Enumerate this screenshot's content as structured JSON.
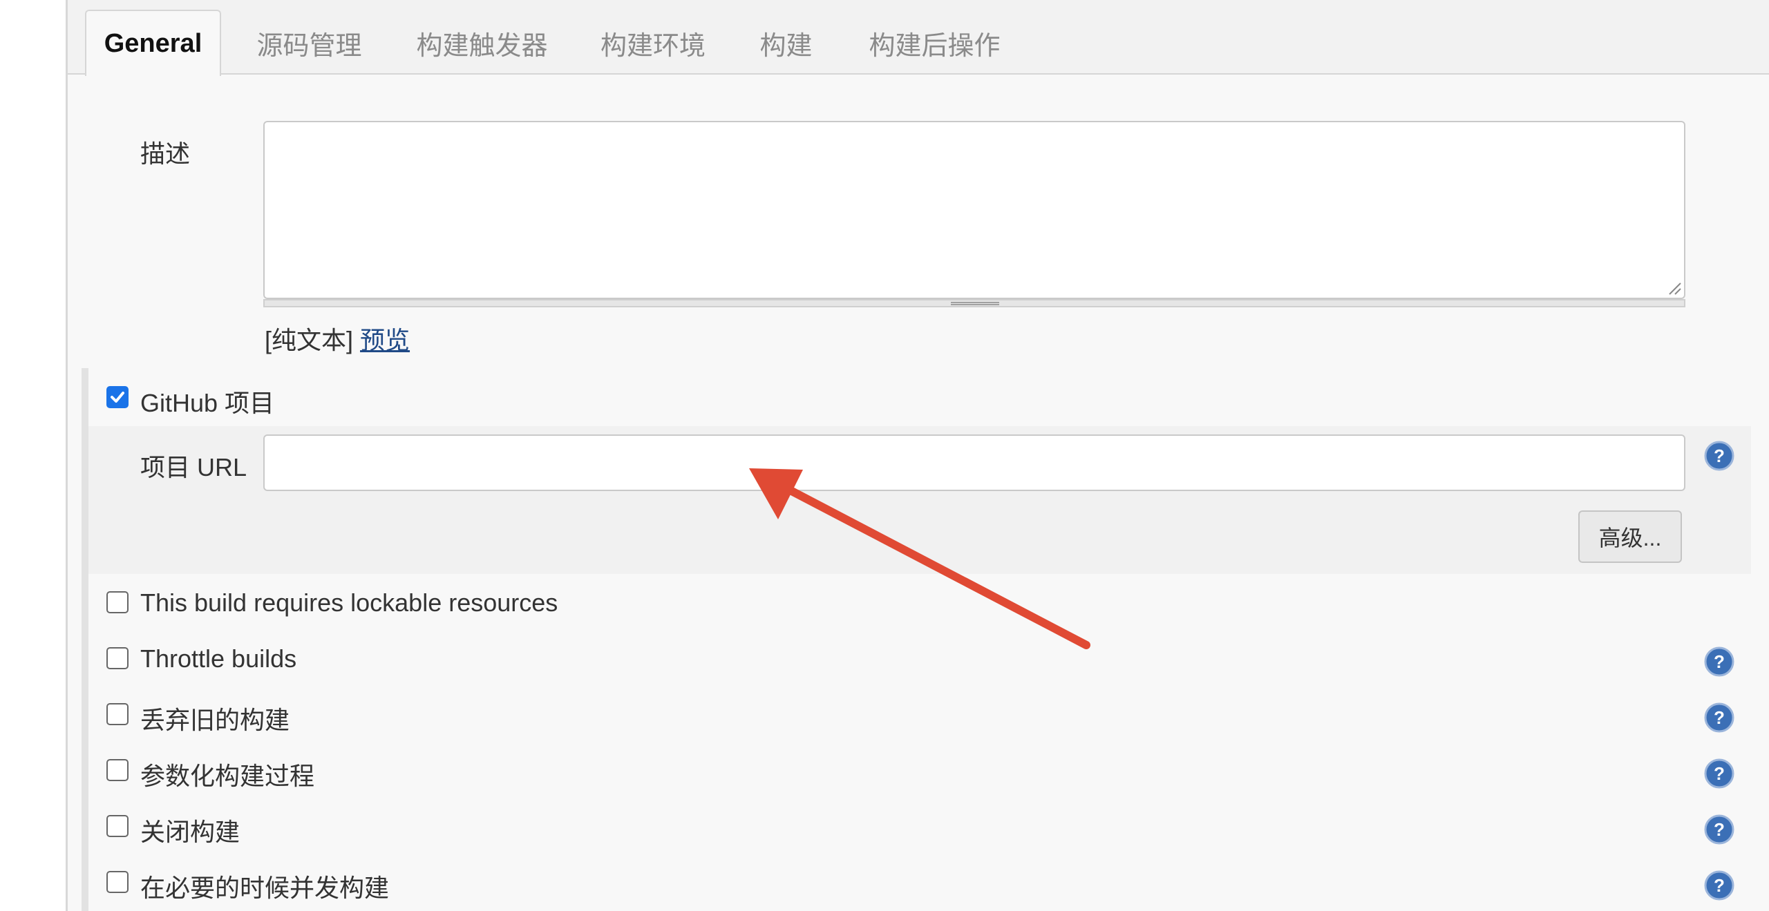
{
  "tabs": [
    {
      "label": "General"
    },
    {
      "label": "源码管理"
    },
    {
      "label": "构建触发器"
    },
    {
      "label": "构建环境"
    },
    {
      "label": "构建"
    },
    {
      "label": "构建后操作"
    }
  ],
  "description": {
    "label": "描述",
    "value": "",
    "markup_prefix": "[纯文本]",
    "preview_link": "预览"
  },
  "github_project": {
    "label": "GitHub 项目",
    "checked": true,
    "url_label": "项目 URL",
    "url_value": "",
    "advanced_button": "高级..."
  },
  "options": [
    {
      "label": "This build requires lockable resources",
      "checked": false
    },
    {
      "label": "Throttle builds",
      "checked": false
    },
    {
      "label": "丢弃旧的构建",
      "checked": false
    },
    {
      "label": "参数化构建过程",
      "checked": false
    },
    {
      "label": "关闭构建",
      "checked": false
    },
    {
      "label": "在必要的时候并发构建",
      "checked": false
    }
  ],
  "colors": {
    "annotation_arrow": "#e04a34",
    "checkbox_checked": "#1a73e8",
    "help_icon": "#3b6fb6",
    "link": "#204a87"
  },
  "icons": {
    "help": "help-icon",
    "checkmark": "checkmark-icon",
    "resize": "resize-handle-icon",
    "annotation": "arrow-annotation"
  }
}
